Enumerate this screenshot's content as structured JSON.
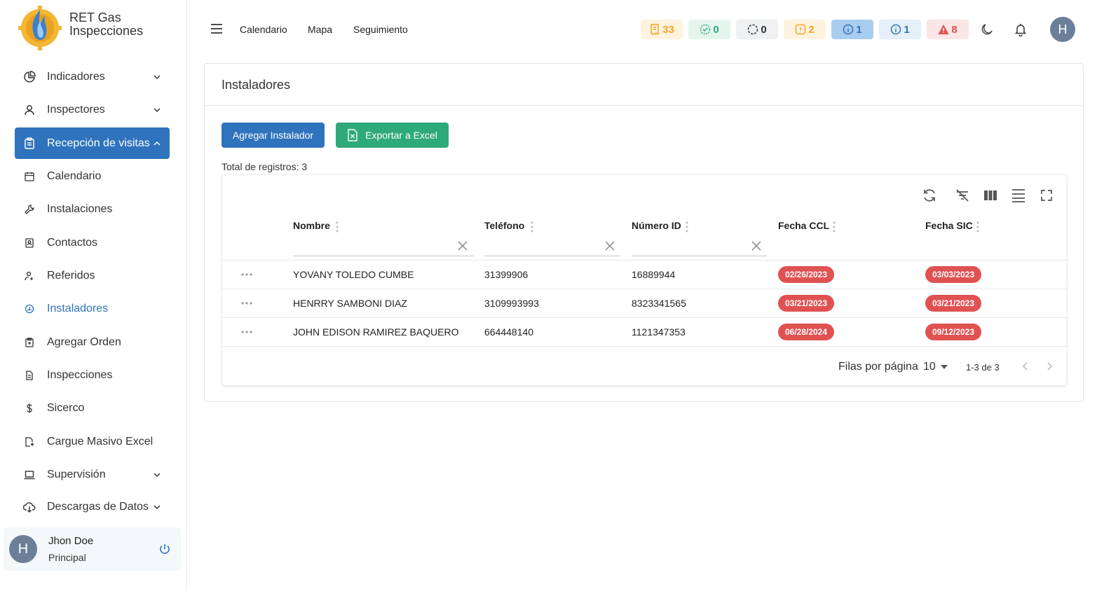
{
  "brand": {
    "name": "RET Gas Inspecciones"
  },
  "sidebar": {
    "items": [
      {
        "label": "Indicadores",
        "icon": "pie-chart-icon"
      },
      {
        "label": "Inspectores",
        "icon": "user-icon"
      },
      {
        "label": "Recepción de visitas",
        "icon": "clipboard-icon"
      },
      {
        "label": "Calendario",
        "icon": "calendar-icon"
      },
      {
        "label": "Instalaciones",
        "icon": "wrench-icon"
      },
      {
        "label": "Contactos",
        "icon": "contacts-icon"
      },
      {
        "label": "Referidos",
        "icon": "user-referral-icon"
      },
      {
        "label": "Instaladores",
        "icon": "installer-icon"
      },
      {
        "label": "Agregar Orden",
        "icon": "add-order-icon"
      },
      {
        "label": "Inspecciones",
        "icon": "document-icon"
      },
      {
        "label": "Sicerco",
        "icon": "dollar-icon"
      },
      {
        "label": "Cargue Masivo Excel",
        "icon": "upload-file-icon"
      },
      {
        "label": "Supervisión",
        "icon": "laptop-icon"
      },
      {
        "label": "Descargas de Datos",
        "icon": "cloud-download-icon"
      }
    ]
  },
  "user": {
    "initial": "H",
    "name": "Jhon Doe",
    "role": "Principal"
  },
  "topbar": {
    "links": [
      "Calendario",
      "Mapa",
      "Seguimiento"
    ],
    "badges": [
      {
        "value": "33",
        "color": "#f5a623",
        "bg": "#fdf3df",
        "icon": "receipt-icon"
      },
      {
        "value": "0",
        "color": "#2eaa78",
        "bg": "#e4f5ee",
        "icon": "check-circle-icon"
      },
      {
        "value": "0",
        "color": "#333333",
        "bg": "#eef0f2",
        "icon": "loading-circle-icon"
      },
      {
        "value": "2",
        "color": "#f5a623",
        "bg": "#fdf3df",
        "icon": "warning-square-icon"
      },
      {
        "value": "1",
        "color": "#2f73bd",
        "bg": "#a9cdef",
        "icon": "info-icon"
      },
      {
        "value": "1",
        "color": "#2f73bd",
        "bg": "#e6f0fa",
        "icon": "info-icon"
      },
      {
        "value": "8",
        "color": "#e05252",
        "bg": "#fbe6e6",
        "icon": "alert-triangle-icon"
      }
    ],
    "avatar_initial": "H"
  },
  "card": {
    "title": "Instaladores",
    "add_button": "Agregar Instalador",
    "export_button": "Exportar a Excel",
    "total_label": "Total de registros: 3"
  },
  "table": {
    "columns": [
      "Nombre",
      "Teléfono",
      "Número ID",
      "Fecha CCL",
      "Fecha SIC"
    ],
    "rows": [
      {
        "nombre": "YOVANY TOLEDO CUMBE",
        "telefono": "31399906",
        "numero_id": "16889944",
        "fecha_ccl": "02/26/2023",
        "fecha_sic": "03/03/2023"
      },
      {
        "nombre": "HENRRY SAMBONI DIAZ",
        "telefono": "3109993993",
        "numero_id": "8323341565",
        "fecha_ccl": "03/21/2023",
        "fecha_sic": "03/21/2023"
      },
      {
        "nombre": "JOHN EDISON RAMIREZ BAQUERO",
        "telefono": "664448140",
        "numero_id": "1121347353",
        "fecha_ccl": "06/28/2024",
        "fecha_sic": "09/12/2023"
      }
    ],
    "rows_per_page_label": "Filas por página",
    "rows_per_page_value": "10",
    "range": "1-3 de 3"
  },
  "colors": {
    "primary": "#2f73bd",
    "success": "#2eaa78",
    "danger": "#e05252"
  }
}
